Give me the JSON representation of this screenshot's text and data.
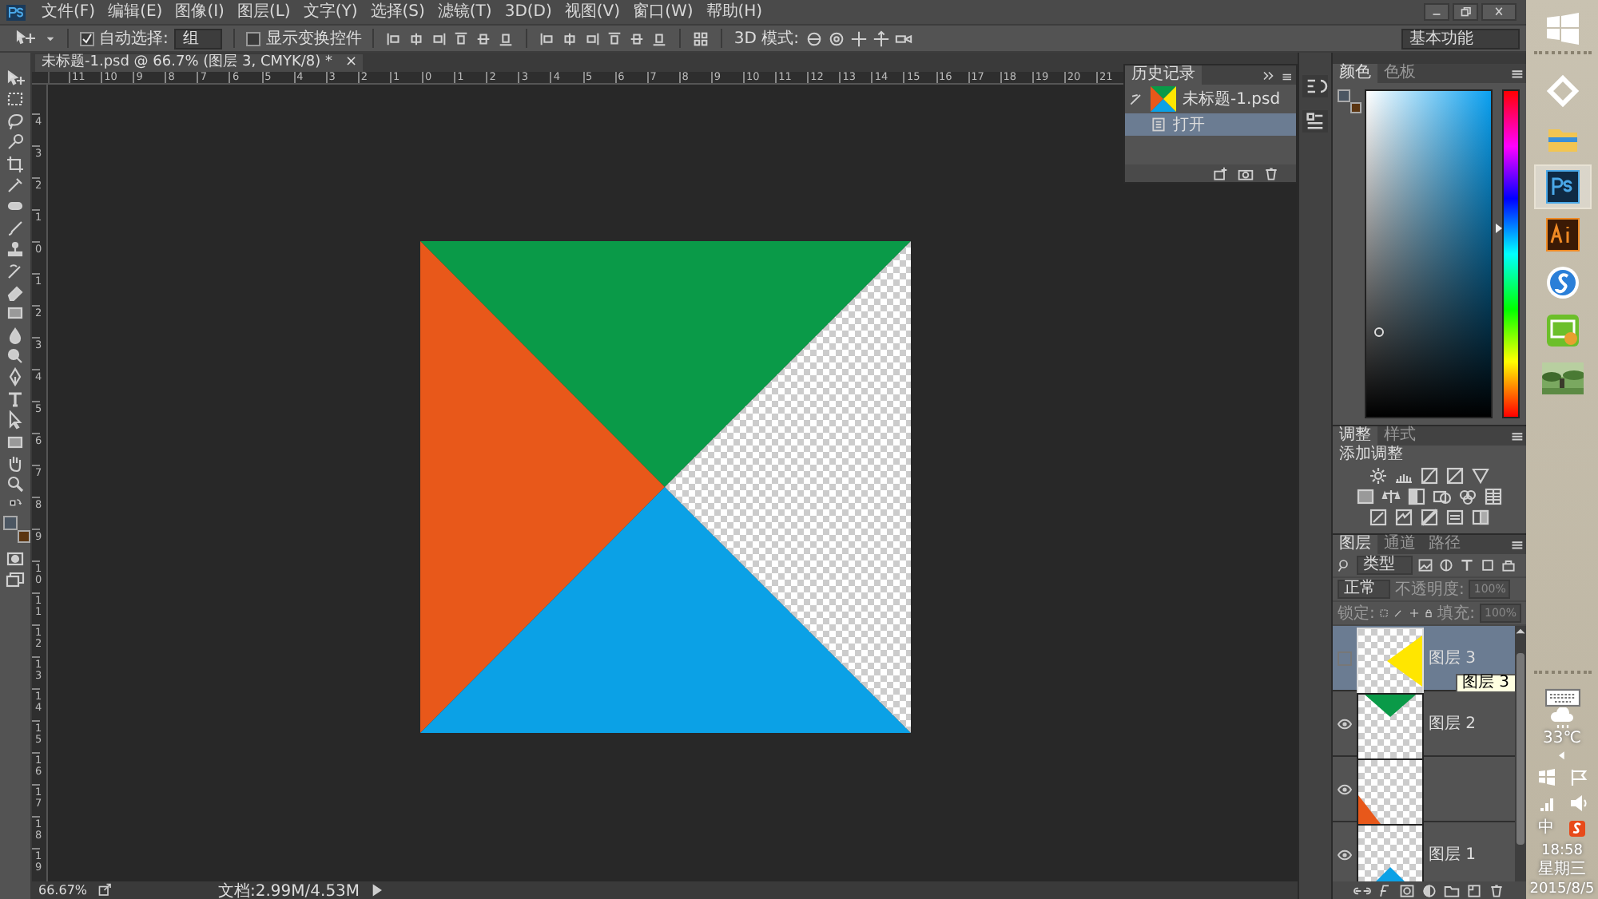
{
  "menu": {
    "items": [
      "文件(F)",
      "编辑(E)",
      "图像(I)",
      "图层(L)",
      "文字(Y)",
      "选择(S)",
      "滤镜(T)",
      "3D(D)",
      "视图(V)",
      "窗口(W)",
      "帮助(H)"
    ]
  },
  "options_bar": {
    "auto_select": {
      "label": "自动选择:",
      "checked": true
    },
    "auto_select_target": "组",
    "show_transform": {
      "label": "显示变换控件",
      "checked": false
    },
    "mode_3d_label": "3D 模式:",
    "workspace": "基本功能"
  },
  "document": {
    "tab_title": "未标题-1.psd @ 66.7% (图层 3, CMYK/8) *",
    "tab_close": "×",
    "top_ruler": [
      "11",
      "10",
      "9",
      "8",
      "7",
      "6",
      "5",
      "4",
      "3",
      "2",
      "1",
      "0",
      "1",
      "2",
      "3",
      "4",
      "5",
      "6",
      "7",
      "8",
      "9",
      "10",
      "11",
      "12",
      "13",
      "14",
      "15",
      "16",
      "17",
      "18",
      "19",
      "20",
      "21"
    ],
    "left_ruler": [
      "4",
      "3",
      "2",
      "1",
      "0",
      "1",
      "2",
      "3",
      "4",
      "5",
      "6",
      "7",
      "8",
      "9",
      "10",
      "11",
      "12",
      "13",
      "14",
      "15",
      "16",
      "17",
      "18",
      "19"
    ]
  },
  "toolbar": {
    "swatches": [
      {
        "color": "#4b5662"
      },
      {
        "color": "#5b3511"
      }
    ]
  },
  "history": {
    "tab": "历史记录",
    "snapshot": "未标题-1.psd",
    "states": [
      {
        "label": "打开",
        "selected": true
      }
    ]
  },
  "color_panel": {
    "tabs": [
      {
        "label": "颜色",
        "selected": true
      },
      {
        "label": "色板",
        "selected": false
      }
    ],
    "hue_slider": {
      "level": 0.58
    }
  },
  "adjustments": {
    "tabs": [
      {
        "label": "调整",
        "selected": true
      },
      {
        "label": "样式",
        "selected": false
      }
    ],
    "title": "添加调整"
  },
  "layers_panel": {
    "tabs": [
      {
        "label": "图层",
        "selected": true
      },
      {
        "label": "通道",
        "selected": false
      },
      {
        "label": "路径",
        "selected": false
      }
    ],
    "filter": "类型",
    "blend_mode": "正常",
    "opacity_label": "不透明度:",
    "opacity": "100%",
    "lock_label": "锁定:",
    "fill_label": "填充:",
    "fill": "100%",
    "tooltip": "图层 3",
    "layers": [
      {
        "name": "图层 3",
        "selected": true,
        "visible": false,
        "kind": "right",
        "color": "#ffe600"
      },
      {
        "name": "图层 2",
        "selected": false,
        "visible": true,
        "kind": "top",
        "color": "#0a9a48"
      },
      {
        "selected": false,
        "visible": true,
        "kind": "left",
        "color": "#e8581a"
      },
      {
        "name": "图层 1",
        "selected": false,
        "visible": true,
        "kind": "bottom",
        "color": "#0ba1e6"
      }
    ]
  },
  "status_bar": {
    "zoom": "66.67%",
    "doc_size": "文档:2.99M/4.53M"
  },
  "taskbar": {
    "temperature": "33℃",
    "ime": "中",
    "time": "18:58",
    "weekday": "星期三",
    "date": "2015/8/5"
  }
}
